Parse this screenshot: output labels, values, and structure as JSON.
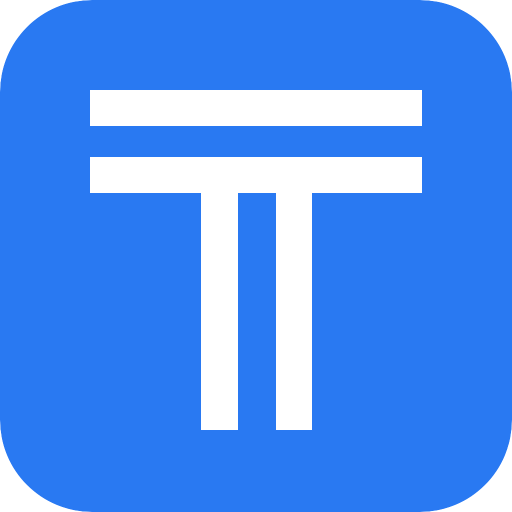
{
  "icon": {
    "name": "t-logo-icon",
    "background_color": "#2979f2",
    "glyph_color": "#ffffff"
  }
}
